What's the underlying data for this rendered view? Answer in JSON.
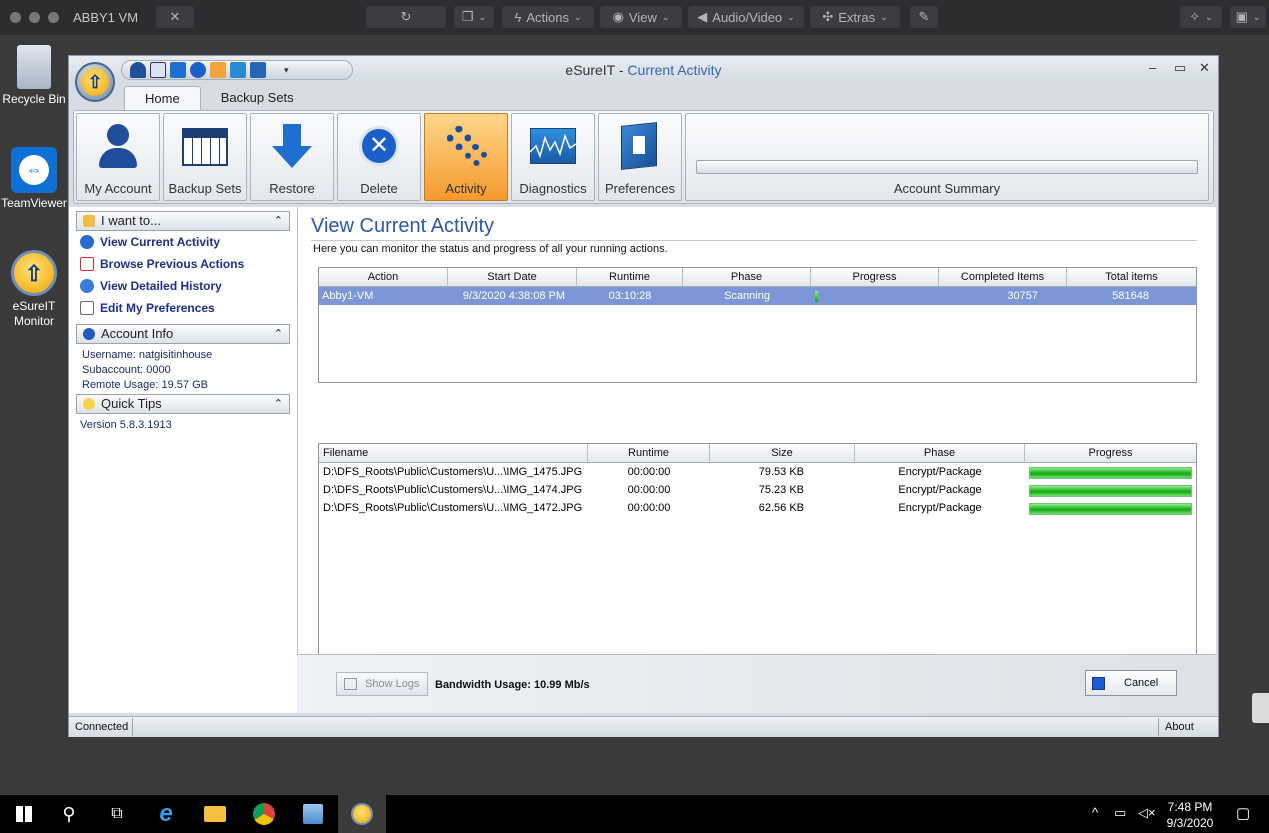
{
  "vm_bar": {
    "title": "ABBY1 VM",
    "actions": "Actions",
    "view": "View",
    "audio_video": "Audio/Video",
    "extras": "Extras"
  },
  "desktop_icons": [
    {
      "label": "Recycle Bin"
    },
    {
      "label": "TeamViewer"
    },
    {
      "label": "eSureIT Monitor"
    }
  ],
  "window": {
    "title_app": "eSureIT",
    "title_sep": " - ",
    "title_view": "Current Activity",
    "tabs": [
      "Home",
      "Backup Sets"
    ],
    "ribbon": [
      "My Account",
      "Backup Sets",
      "Restore",
      "Delete",
      "Activity",
      "Diagnostics",
      "Preferences"
    ],
    "account_summary": "Account Summary"
  },
  "left_pane": {
    "i_want_to": "I want to...",
    "links": [
      "View Current Activity",
      "Browse Previous Actions",
      "View Detailed History",
      "Edit My Preferences"
    ],
    "account_info": "Account Info",
    "username": "Username: natgisitinhouse",
    "subaccount": "Subaccount: 0000",
    "remote_usage": "Remote Usage: 19.57 GB",
    "quick_tips": "Quick Tips",
    "version": "Version 5.8.3.1913"
  },
  "main": {
    "title": "View Current Activity",
    "description": "Here you can monitor the status and progress of all your running actions.",
    "actions_table": {
      "headers": [
        "Action",
        "Start Date",
        "Runtime",
        "Phase",
        "Progress",
        "Completed Items",
        "Total items"
      ],
      "rows": [
        {
          "action": "Abby1-VM",
          "start_date": "9/3/2020 4:38:08 PM",
          "runtime": "03:10:28",
          "phase": "Scanning",
          "progress": 0.01,
          "completed": "30757",
          "total": "581648"
        }
      ]
    },
    "files_table": {
      "headers": [
        "Filename",
        "Runtime",
        "Size",
        "Phase",
        "Progress"
      ],
      "rows": [
        {
          "filename": "D:\\DFS_Roots\\Public\\Customers\\U...\\IMG_1475.JPG",
          "runtime": "00:00:00",
          "size": "79.53 KB",
          "phase": "Encrypt/Package",
          "progress": 1.0
        },
        {
          "filename": "D:\\DFS_Roots\\Public\\Customers\\U...\\IMG_1474.JPG",
          "runtime": "00:00:00",
          "size": "75.23 KB",
          "phase": "Encrypt/Package",
          "progress": 1.0
        },
        {
          "filename": "D:\\DFS_Roots\\Public\\Customers\\U...\\IMG_1472.JPG",
          "runtime": "00:00:00",
          "size": "62.56 KB",
          "phase": "Encrypt/Package",
          "progress": 1.0
        }
      ]
    },
    "show_logs": "Show Logs",
    "bandwidth": "Bandwidth Usage: 10.99 Mb/s",
    "cancel": "Cancel"
  },
  "statusbar": {
    "left": "Connected",
    "right": "About"
  },
  "taskbar": {
    "time": "7:48 PM",
    "date": "9/3/2020"
  }
}
